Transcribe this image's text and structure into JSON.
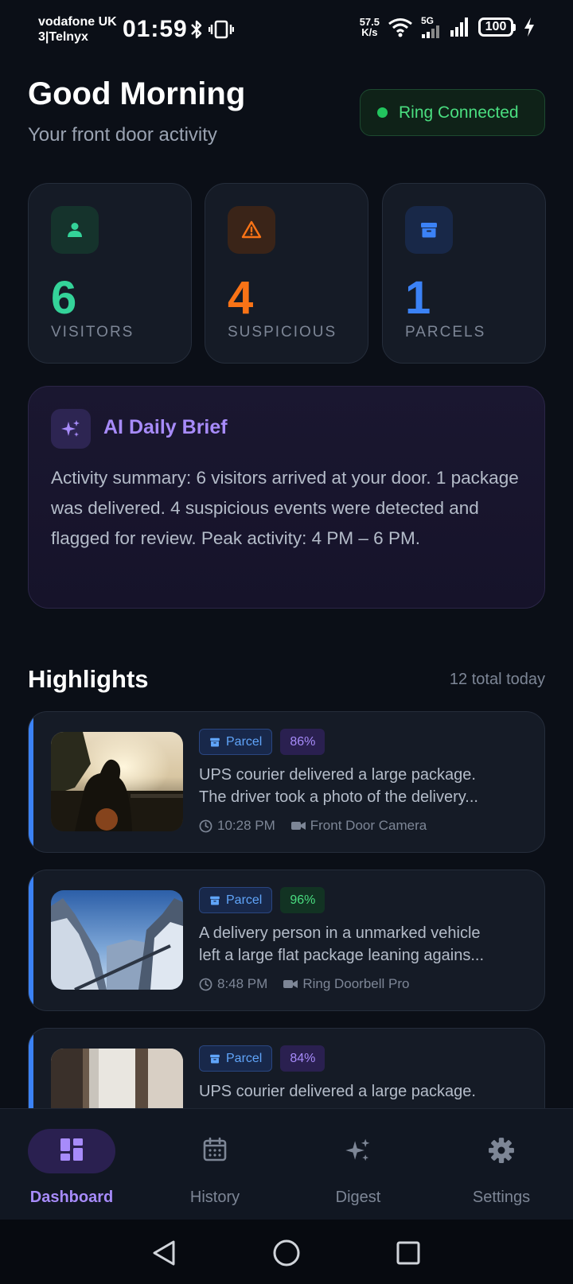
{
  "status_bar": {
    "carrier_line1": "vodafone UK",
    "carrier_line2": "3|Telnyx",
    "time": "01:59",
    "speed_value": "57.5",
    "speed_unit": "K/s",
    "network_5g": "5G",
    "battery": "100"
  },
  "header": {
    "greeting": "Good Morning",
    "subtitle": "Your front door activity",
    "connection_status": "Ring Connected",
    "connection_color": "#22c55e"
  },
  "stats": [
    {
      "value": "6",
      "label": "VISITORS",
      "color": "#34d399",
      "icon": "person-icon"
    },
    {
      "value": "4",
      "label": "SUSPICIOUS",
      "color": "#f97316",
      "icon": "warning-icon"
    },
    {
      "value": "1",
      "label": "PARCELS",
      "color": "#3b82f6",
      "icon": "archive-box-icon"
    }
  ],
  "brief": {
    "title": "AI Daily Brief",
    "text": "Activity summary: 6 visitors arrived at your door. 1 package was delivered. 4 suspicious events were detected and flagged for review. Peak activity: 4 PM – 6 PM."
  },
  "highlights": {
    "title": "Highlights",
    "count_text": "12 total today",
    "items": [
      {
        "tag": "Parcel",
        "confidence": "86%",
        "line1": "UPS courier delivered a large package.",
        "line2": "The driver took a photo of the delivery...",
        "time": "10:28 PM",
        "camera": "Front Door Camera"
      },
      {
        "tag": "Parcel",
        "confidence": "96%",
        "line1": "A delivery person in a unmarked vehicle",
        "line2": "left a large flat package leaning agains...",
        "time": "8:48 PM",
        "camera": "Ring Doorbell Pro"
      },
      {
        "tag": "Parcel",
        "confidence": "84%",
        "line1": "UPS courier delivered a large package.",
        "line2": ""
      }
    ]
  },
  "nav": {
    "items": [
      {
        "label": "Dashboard",
        "icon": "dashboard-icon",
        "active": true
      },
      {
        "label": "History",
        "icon": "calendar-icon",
        "active": false
      },
      {
        "label": "Digest",
        "icon": "sparkles-icon",
        "active": false
      },
      {
        "label": "Settings",
        "icon": "gear-icon",
        "active": false
      }
    ]
  },
  "colors": {
    "accent": "#a78bfa",
    "parcel_blue": "#3b82f6",
    "background": "#0b0f17"
  }
}
